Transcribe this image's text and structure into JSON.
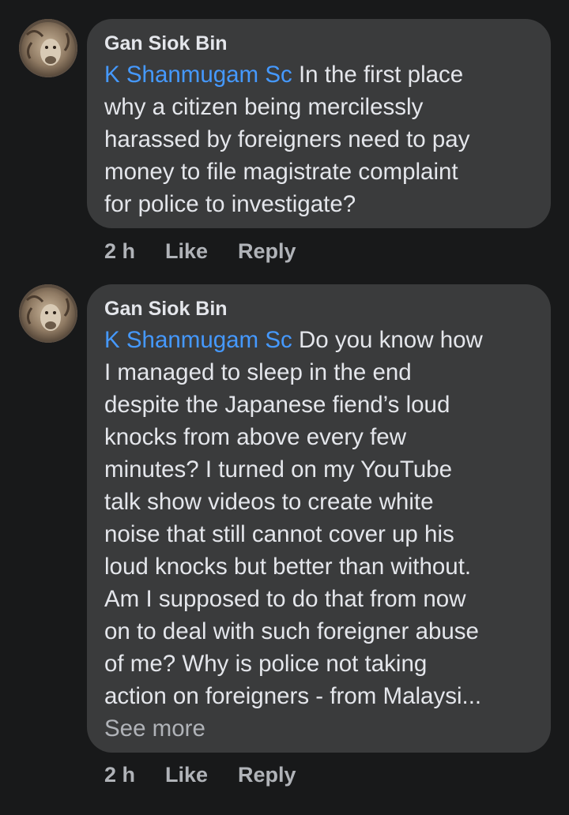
{
  "comments": [
    {
      "author": "Gan Siok Bin",
      "mention": "K Shanmugam Sc",
      "text": " In the first place\nwhy a citizen being mercilessly\nharassed by foreigners need to pay\nmoney to file magistrate complaint\nfor police to investigate?",
      "time": "2 h",
      "like_label": "Like",
      "reply_label": "Reply"
    },
    {
      "author": "Gan Siok Bin",
      "mention": "K Shanmugam Sc",
      "text": " Do you know how\nI managed to sleep in the end\ndespite the Japanese fiend’s loud\nknocks from above every few\nminutes? I turned on my YouTube\ntalk show videos to create white\nnoise that still cannot cover up his\nloud knocks but better than without.\nAm I supposed to do that from now\non to deal with such foreigner abuse\nof me? Why is police not taking\naction on foreigners - from Malaysi...",
      "see_more": "See more",
      "time": "2 h",
      "like_label": "Like",
      "reply_label": "Reply"
    }
  ],
  "colors": {
    "background": "#18191a",
    "bubble": "#3a3b3c",
    "mention": "#4599ff",
    "text": "#e4e6eb",
    "secondary": "#b0b3b8"
  },
  "icons": {
    "avatar": "lion-avatar"
  }
}
